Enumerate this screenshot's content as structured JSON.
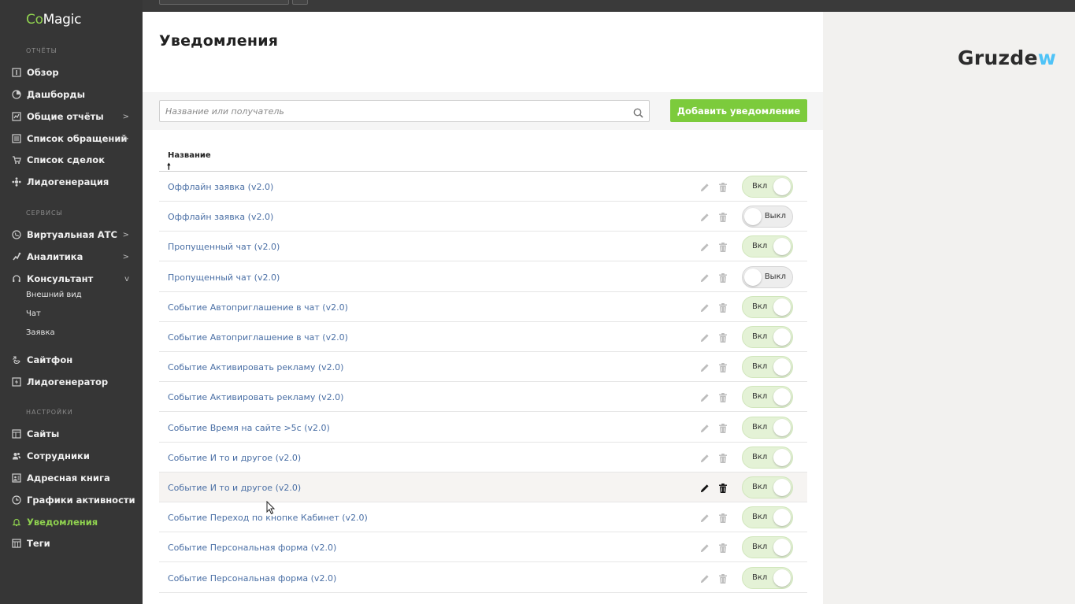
{
  "app": {
    "logo_prefix": "Co",
    "logo_suffix": "Magic"
  },
  "sidebar": {
    "sections": [
      {
        "label": "ОТЧЁТЫ"
      },
      {
        "label": "СЕРВИСЫ"
      },
      {
        "label": "НАСТРОЙКИ"
      }
    ],
    "items": [
      {
        "label": "Обзор",
        "icon": "overview-icon"
      },
      {
        "label": "Дашборды",
        "icon": "pie-chart-icon"
      },
      {
        "label": "Общие отчёты",
        "icon": "chart-icon",
        "arrow": ">"
      },
      {
        "label": "Список обращений",
        "icon": "list-icon",
        "arrow": ">"
      },
      {
        "label": "Список сделок",
        "icon": "cart-icon"
      },
      {
        "label": "Лидогенерация",
        "icon": "leadgen-icon"
      },
      {
        "label": "Виртуальная АТС",
        "icon": "phone-icon",
        "arrow": ">"
      },
      {
        "label": "Аналитика",
        "icon": "analytics-icon",
        "arrow": ">"
      },
      {
        "label": "Консультант",
        "icon": "headset-icon",
        "arrow": "v"
      },
      {
        "label": "Сайтфон",
        "icon": "callback-icon"
      },
      {
        "label": "Лидогенератор",
        "icon": "generator-icon"
      },
      {
        "label": "Сайты",
        "icon": "sites-icon"
      },
      {
        "label": "Сотрудники",
        "icon": "users-icon"
      },
      {
        "label": "Адресная книга",
        "icon": "addressbook-icon"
      },
      {
        "label": "Графики активности",
        "icon": "clock-icon"
      },
      {
        "label": "Уведомления",
        "icon": "bell-icon",
        "active": true
      },
      {
        "label": "Теги",
        "icon": "tags-icon"
      }
    ],
    "subitems": [
      "Внешний вид",
      "Чат",
      "Заявка"
    ]
  },
  "main": {
    "title": "Уведомления",
    "search_placeholder": "Название или получатель",
    "add_button": "Добавить уведомление",
    "column_header": "Название",
    "sort_arrow": "🠕"
  },
  "rows": [
    {
      "name": "Оффлайн заявка (v2.0)",
      "state": "Вкл",
      "on": true
    },
    {
      "name": "Оффлайн заявка (v2.0)",
      "state": "Выкл",
      "on": false
    },
    {
      "name": "Пропущенный чат (v2.0)",
      "state": "Вкл",
      "on": true
    },
    {
      "name": "Пропущенный чат (v2.0)",
      "state": "Выкл",
      "on": false
    },
    {
      "name": "Событие Автоприглашение в чат (v2.0)",
      "state": "Вкл",
      "on": true
    },
    {
      "name": "Событие Автоприглашение в чат (v2.0)",
      "state": "Вкл",
      "on": true
    },
    {
      "name": "Событие Активировать рекламу (v2.0)",
      "state": "Вкл",
      "on": true
    },
    {
      "name": "Событие Активировать рекламу (v2.0)",
      "state": "Вкл",
      "on": true
    },
    {
      "name": "Событие Время на сайте >5с (v2.0)",
      "state": "Вкл",
      "on": true
    },
    {
      "name": "Событие И то и другое (v2.0)",
      "state": "Вкл",
      "on": true
    },
    {
      "name": "Событие И то и другое (v2.0)",
      "state": "Вкл",
      "on": true,
      "hover": true
    },
    {
      "name": "Событие Переход по кнопке Кабинет (v2.0)",
      "state": "Вкл",
      "on": true
    },
    {
      "name": "Событие Персональная форма (v2.0)",
      "state": "Вкл",
      "on": true
    },
    {
      "name": "Событие Персональная форма (v2.0)",
      "state": "Вкл",
      "on": true
    }
  ],
  "brand": {
    "prefix": "Gruzde",
    "suffix": "w"
  },
  "colors": {
    "accent": "#7ccb3c",
    "link": "#4a6fa5",
    "sidebar_bg": "#363636"
  }
}
